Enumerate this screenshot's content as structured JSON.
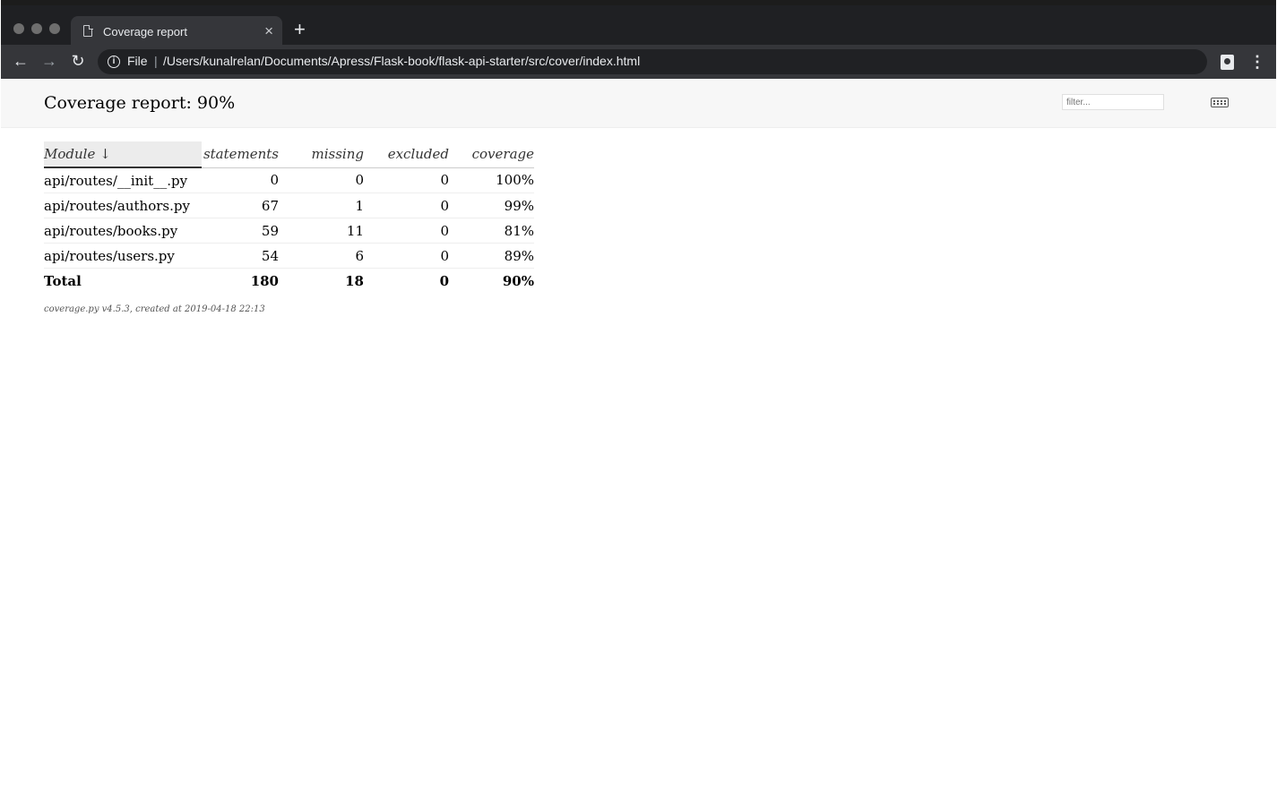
{
  "browser": {
    "tab_title": "Coverage report",
    "close_glyph": "×",
    "new_tab_glyph": "+",
    "back_glyph": "←",
    "forward_glyph": "→",
    "reload_glyph": "↻",
    "info_glyph": "i",
    "scheme_label": "File",
    "separator": "|",
    "url": "/Users/kunalrelan/Documents/Apress/Flask-book/flask-api-starter/src/cover/index.html",
    "menu_glyph": "⋮",
    "icons": [
      "page-icon",
      "close-icon",
      "plus-icon",
      "back-arrow-icon",
      "forward-arrow-icon",
      "reload-icon",
      "info-icon",
      "profile-icon",
      "menu-icon"
    ]
  },
  "header": {
    "title": "Coverage report: 90%",
    "filter_placeholder": "filter...",
    "keyboard_icon": "keyboard-icon"
  },
  "table": {
    "columns": [
      "Module ↓",
      "statements",
      "missing",
      "excluded",
      "coverage"
    ],
    "rows": [
      {
        "module": "api/routes/__init__.py",
        "statements": "0",
        "missing": "0",
        "excluded": "0",
        "coverage": "100%"
      },
      {
        "module": "api/routes/authors.py",
        "statements": "67",
        "missing": "1",
        "excluded": "0",
        "coverage": "99%"
      },
      {
        "module": "api/routes/books.py",
        "statements": "59",
        "missing": "11",
        "excluded": "0",
        "coverage": "81%"
      },
      {
        "module": "api/routes/users.py",
        "statements": "54",
        "missing": "6",
        "excluded": "0",
        "coverage": "89%"
      }
    ],
    "total": {
      "module": "Total",
      "statements": "180",
      "missing": "18",
      "excluded": "0",
      "coverage": "90%"
    }
  },
  "footer": {
    "text": "coverage.py v4.5.3, created at 2019-04-18 22:13"
  }
}
